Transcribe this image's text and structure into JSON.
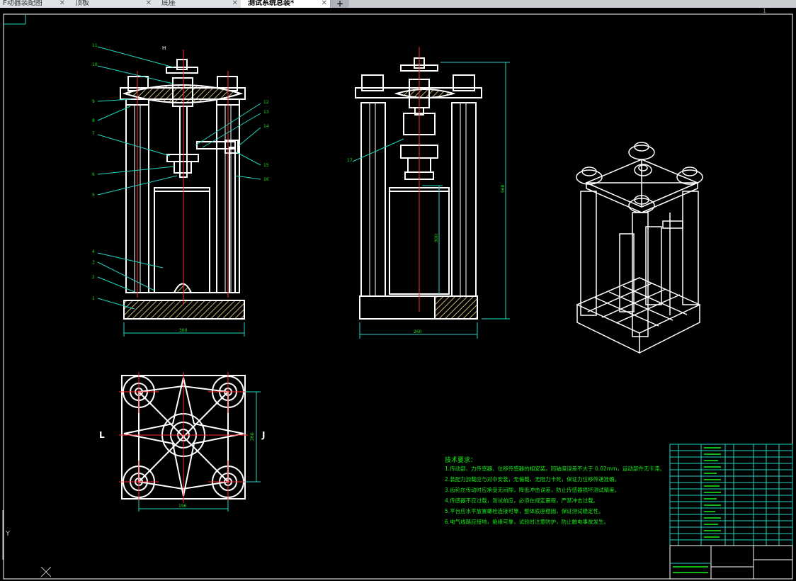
{
  "tabs": [
    {
      "label": "F动器装配图",
      "close": "✕"
    },
    {
      "label": "顶板",
      "close": "✕"
    },
    {
      "label": "底座",
      "close": "✕"
    },
    {
      "label": "测试系统总装*",
      "close": "✕"
    }
  ],
  "add_tab": "+",
  "colors": {
    "background": "#000000",
    "lines": "#ffffff",
    "leader": "#1fd6c0",
    "text": "#18e818",
    "center": "#ff2a2a",
    "hatch": "#c8b070"
  },
  "technical_requirements": {
    "title": "技术要求：",
    "items": [
      "1.传动部、力传感器、位移传感器的相安装，同轴度误差不大于 0.02mm，运动部件无卡滞。",
      "2.装配力加载应与对中安装，无偏载，无阻力卡死，保证力位移传递准确。",
      "3.齿轮在传动时应承受无间隙，降低冲击误差，防止传感器损坏测试精度。",
      "4.传感器不应过载，测试前应，必须在规定量程，严禁冲击过载。",
      "5.平台应水平放置螺栓连接可靠，整体底座稳固，保证测试稳定性。",
      "6.电气线路应接地，绝缘可靠，试验时注意防护，防止触电事故发生。"
    ]
  },
  "balloons": [
    "11",
    "10",
    "9",
    "8",
    "7",
    "6",
    "5",
    "4",
    "3",
    "2",
    "1",
    "12",
    "13",
    "14",
    "15",
    "16",
    "17"
  ],
  "dims": {
    "front_width": "300",
    "side_width": "260",
    "side_height": "560",
    "side_inner": "300",
    "plan_width": "196",
    "plan_height": "260"
  },
  "section_marks": {
    "left": "L",
    "right": "J",
    "top": "H"
  },
  "ucs_label": "Y",
  "corner_label": "1"
}
